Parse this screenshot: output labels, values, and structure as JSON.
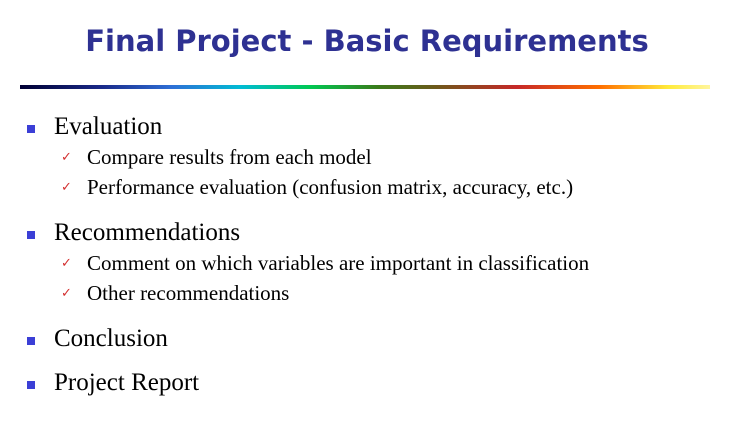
{
  "slide": {
    "title": "Final Project - Basic Requirements",
    "sections": [
      {
        "label": "Evaluation",
        "subitems": [
          "Compare results from each model",
          "Performance evaluation (confusion matrix, accuracy, etc.)"
        ]
      },
      {
        "label": "Recommendations",
        "subitems": [
          "Comment on which variables are important in classification",
          "Other recommendations"
        ]
      },
      {
        "label": "Conclusion",
        "subitems": []
      },
      {
        "label": "Project Report",
        "subitems": []
      }
    ]
  },
  "icons": {
    "level1_bullet": "square-bullet-icon",
    "level2_bullet": "checkmark-icon"
  },
  "colors": {
    "title": "#2e3192",
    "bullet": "#3b3fd6",
    "checkmark": "#d32f2f",
    "text": "#000000"
  }
}
